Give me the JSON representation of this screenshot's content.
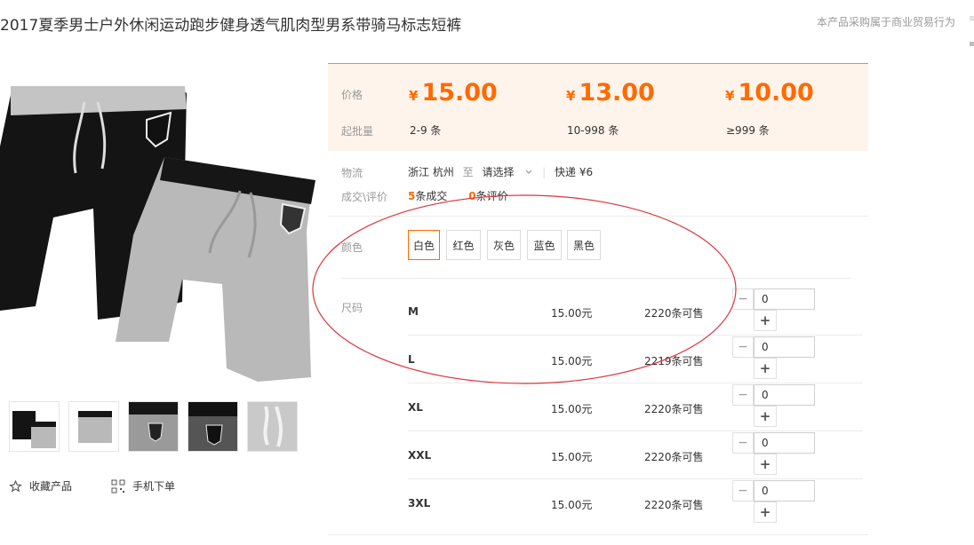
{
  "header": {
    "title": "2017夏季男士户外休闲运动跑步健身透气肌肉型男系带骑马标志短裤",
    "notice": "本产品采购属于商业贸易行为",
    "edge_marks": [
      "≋",
      "▪"
    ]
  },
  "gallery": {
    "favorite_label": "收藏产品",
    "mobile_order_label": "手机下单"
  },
  "pricing": {
    "price_label": "价格",
    "min_order_label": "起批量",
    "currency": "¥",
    "tiers": [
      {
        "price": "15.00",
        "qty": "2-9 条"
      },
      {
        "price": "13.00",
        "qty": "10-998 条"
      },
      {
        "price": "10.00",
        "qty": "≥999 条"
      }
    ]
  },
  "logistics": {
    "label": "物流",
    "origin": "浙江 杭州",
    "to": "至",
    "destination_select": "请选择",
    "express": "快递 ¥6"
  },
  "trade": {
    "label": "成交\\评价",
    "deals_count": "5",
    "deals_unit": "条成交",
    "reviews_count": "0",
    "reviews_unit": "条评价"
  },
  "colors": {
    "label": "颜色",
    "options": [
      "白色",
      "红色",
      "灰色",
      "蓝色",
      "黑色"
    ],
    "selected": "白色"
  },
  "sizes": {
    "label": "尺码",
    "rows": [
      {
        "size": "M",
        "price": "15.00元",
        "stock": "2220条可售",
        "qty": "0"
      },
      {
        "size": "L",
        "price": "15.00元",
        "stock": "2219条可售",
        "qty": "0"
      },
      {
        "size": "XL",
        "price": "15.00元",
        "stock": "2220条可售",
        "qty": "0"
      },
      {
        "size": "XXL",
        "price": "15.00元",
        "stock": "2220条可售",
        "qty": "0"
      },
      {
        "size": "3XL",
        "price": "15.00元",
        "stock": "2220条可售",
        "qty": "0"
      }
    ],
    "minus_symbol": "−",
    "plus_symbol": "+"
  },
  "theme": {
    "accent": "#ff6a00",
    "price_bg": "#fff4eb",
    "annotation": "#d9363e",
    "shorts_black": "#141414",
    "shorts_grey": "#b9b9b9"
  }
}
